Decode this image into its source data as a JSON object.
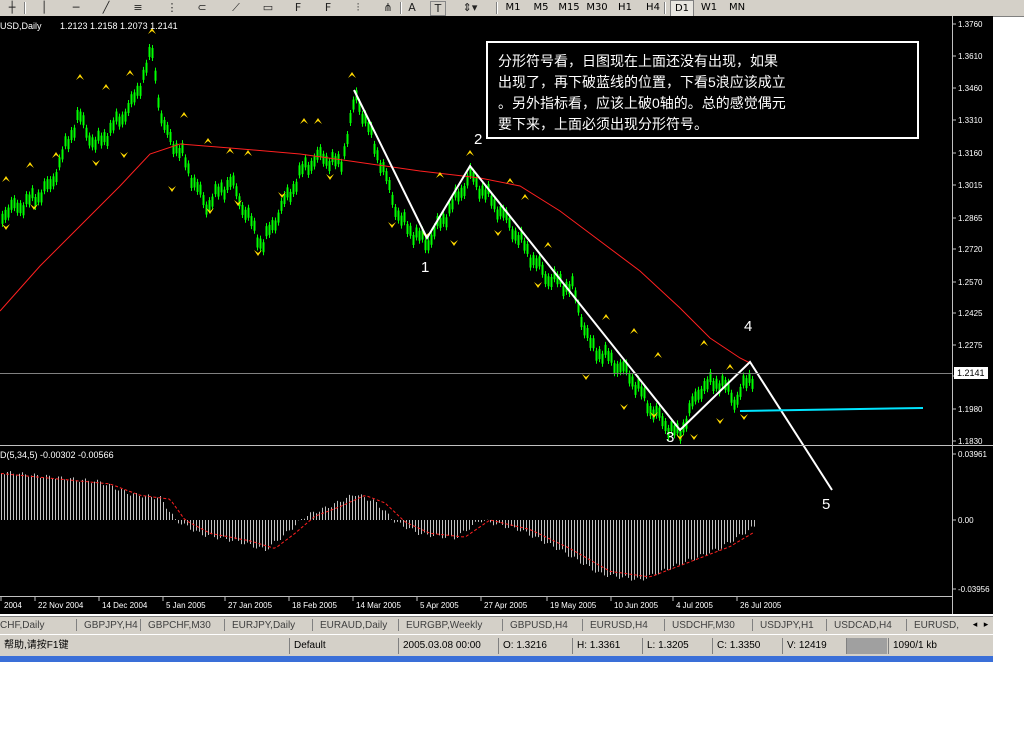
{
  "toolbar": {
    "icons": [
      "crosshair-icon",
      "vertical-line-icon",
      "horizontal-line-icon",
      "trendline-icon",
      "fibonacci-icon",
      "fibonacci-fan-icon",
      "fibonacci-arcs-icon",
      "gann-fan-icon",
      "channel-icon",
      "buy-arrow-icon",
      "sell-arrow-icon",
      "cycle-lines-icon",
      "andrews-pitchfork-icon",
      "triangle-icon",
      "text-icon",
      "label-icon",
      "arrows-icon"
    ],
    "text_tool": "A",
    "label_tool": "T",
    "timeframes": [
      "M1",
      "M5",
      "M15",
      "M30",
      "H1",
      "H4",
      "D1",
      "W1",
      "MN"
    ]
  },
  "chart": {
    "symbol_header": "USD,Daily",
    "ohlc_header": "1.2123 1.2158 1.2073 1.2141",
    "current_price": "1.2141",
    "price_ticks": [
      "1.3760",
      "1.3610",
      "1.3460",
      "1.3310",
      "1.3160",
      "1.3015",
      "1.2865",
      "1.2720",
      "1.2570",
      "1.2425",
      "1.2275",
      "1.2125",
      "1.1980",
      "1.1830"
    ],
    "indicator_header": "D(5,34,5) -0.00302 -0.00566",
    "indicator_ticks": [
      "0.03961",
      "0.00",
      "-0.03956"
    ],
    "date_labels": [
      "2004",
      "22 Nov 2004",
      "14 Dec 2004",
      "5 Jan 2005",
      "27 Jan 2005",
      "18 Feb 2005",
      "14 Mar 2005",
      "5 Apr 2005",
      "27 Apr 2005",
      "19 May 2005",
      "10 Jun 2005",
      "4 Jul 2005",
      "26 Jul 2005"
    ],
    "wave_labels": [
      "1",
      "2",
      "3",
      "4",
      "5"
    ],
    "annotation_lines": [
      "分形符号看，日图现在上面还没有出现，如果",
      "出现了，再下破蓝线的位置，下看5浪应该成立",
      "。另外指标看，应该上破0轴的。总的感觉偶元",
      "要下来，上面必须出现分形符号。"
    ],
    "colors": {
      "background": "#000000",
      "candles": "#00ff00",
      "moving_average": "#ff2020",
      "fractals": "#ffd800",
      "wave_lines": "#ffffff",
      "support_line": "#00e5ff",
      "histogram": "#c0c0c0",
      "signal_line": "#ff2020"
    }
  },
  "tabs": [
    "CHF,Daily",
    "GBPJPY,H4",
    "GBPCHF,M30",
    "EURJPY,Daily",
    "EURAUD,Daily",
    "EURGBP,Weekly",
    "GBPUSD,H4",
    "EURUSD,H4",
    "USDCHF,M30",
    "USDJPY,H1",
    "USDCAD,H4",
    "EURUSD,"
  ],
  "status": {
    "help": "帮助,请按F1键",
    "profile": "Default",
    "datetime": "2005.03.08 00:00",
    "open": "O: 1.3216",
    "high": "H: 1.3361",
    "low": "L: 1.3205",
    "close": "C: 1.3350",
    "volume": "V: 12419",
    "traffic": "1090/1 kb"
  }
}
